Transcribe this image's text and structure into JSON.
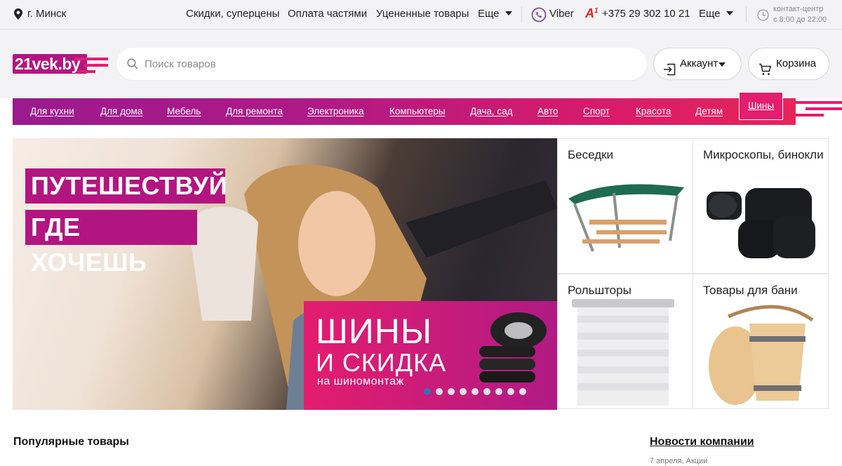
{
  "topbar": {
    "city": "г. Минск",
    "links": [
      "Скидки, суперцены",
      "Оплата частями",
      "Уцененные товары"
    ],
    "more1": "Еще",
    "viber": "Viber",
    "phone": "+375 29 302 10 21",
    "more2": "Еще",
    "contact_line1": "контакт-центр",
    "contact_line2": "с 8:00 до 22:00"
  },
  "header": {
    "logo": "21vek.by",
    "search_placeholder": "Поиск товаров",
    "account": "Аккаунт",
    "cart": "Корзина"
  },
  "menu": {
    "items": [
      "Для кухни",
      "Для дома",
      "Мебель",
      "Для ремонта",
      "Электроника",
      "Компьютеры",
      "Дача, сад",
      "Авто",
      "Спорт",
      "Красота",
      "Детям"
    ],
    "active": "Шины"
  },
  "hero": {
    "headline1": "ПУТЕШЕСТВУЙ",
    "headline2": "ГДЕ ХОЧЕШЬ",
    "promo1": "ШИНЫ",
    "promo2": "И СКИДКА",
    "promo3": "на шиномонтаж",
    "slides_total": 9,
    "active_slide": 1
  },
  "tiles": [
    {
      "label": "Беседки"
    },
    {
      "label": "Микроскопы, бинокли"
    },
    {
      "label": "Рольшторы"
    },
    {
      "label": "Товары для бани"
    }
  ],
  "sections": {
    "popular": "Популярные товары",
    "news": "Новости компании",
    "news_item": "7 апреля, Акции"
  },
  "colors": {
    "brand": "#b31580",
    "accent": "#e41d6e",
    "header_bg": "#f3f3f6"
  }
}
